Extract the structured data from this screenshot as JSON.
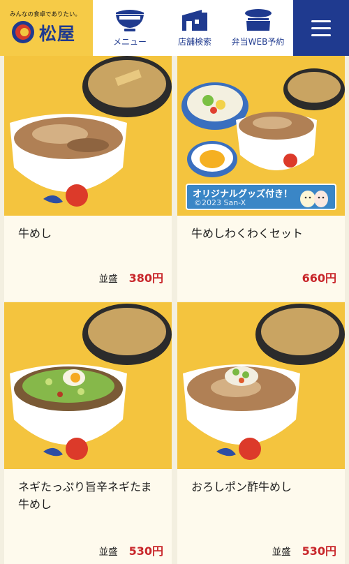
{
  "header": {
    "tagline": "みんなの食卓でありたい。",
    "brand": "松屋",
    "nav": [
      {
        "label": "メニュー",
        "icon": "bowl-icon"
      },
      {
        "label": "店舗検索",
        "icon": "store-icon"
      },
      {
        "label": "弁当WEB予約",
        "icon": "bento-icon"
      }
    ],
    "menu_icon": "hamburger-menu-icon"
  },
  "items": [
    {
      "name": "牛めし",
      "size": "並盛",
      "price": "380円"
    },
    {
      "name": "牛めしわくわくセット",
      "size": "",
      "price": "660円",
      "banner": {
        "title": "オリジナルグッズ付き！",
        "copyright": "©2023 San-X"
      }
    },
    {
      "name": "ネギたっぷり旨辛ネギたま牛めし",
      "size": "並盛",
      "price": "530円"
    },
    {
      "name": "おろしポン酢牛めし",
      "size": "並盛",
      "price": "530円"
    }
  ],
  "colors": {
    "brand_blue": "#1f3a8f",
    "brand_yellow": "#f6cb47",
    "price_red": "#c8262a"
  }
}
